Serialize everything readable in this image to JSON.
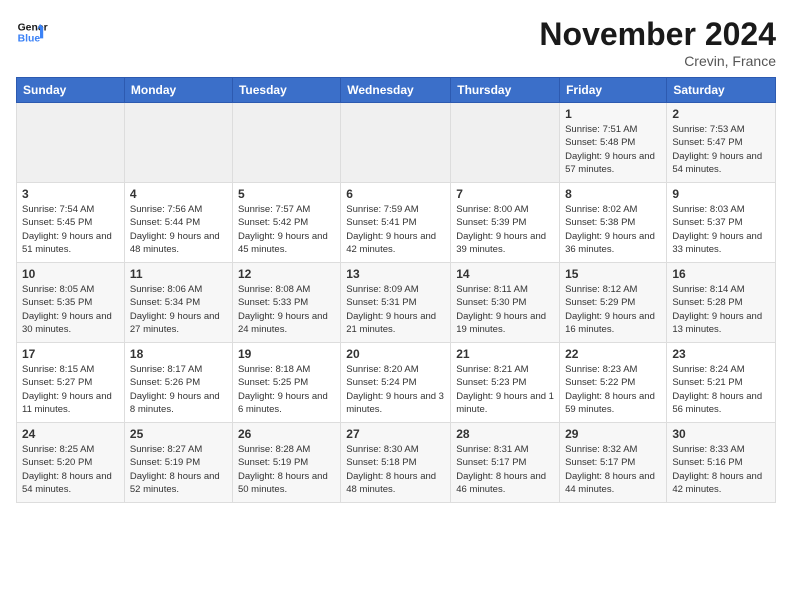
{
  "logo": {
    "line1": "General",
    "line2": "Blue"
  },
  "title": "November 2024",
  "location": "Crevin, France",
  "days_header": [
    "Sunday",
    "Monday",
    "Tuesday",
    "Wednesday",
    "Thursday",
    "Friday",
    "Saturday"
  ],
  "weeks": [
    {
      "days": [
        {
          "number": "",
          "info": ""
        },
        {
          "number": "",
          "info": ""
        },
        {
          "number": "",
          "info": ""
        },
        {
          "number": "",
          "info": ""
        },
        {
          "number": "",
          "info": ""
        },
        {
          "number": "1",
          "info": "Sunrise: 7:51 AM\nSunset: 5:48 PM\nDaylight: 9 hours and 57 minutes."
        },
        {
          "number": "2",
          "info": "Sunrise: 7:53 AM\nSunset: 5:47 PM\nDaylight: 9 hours and 54 minutes."
        }
      ]
    },
    {
      "days": [
        {
          "number": "3",
          "info": "Sunrise: 7:54 AM\nSunset: 5:45 PM\nDaylight: 9 hours and 51 minutes."
        },
        {
          "number": "4",
          "info": "Sunrise: 7:56 AM\nSunset: 5:44 PM\nDaylight: 9 hours and 48 minutes."
        },
        {
          "number": "5",
          "info": "Sunrise: 7:57 AM\nSunset: 5:42 PM\nDaylight: 9 hours and 45 minutes."
        },
        {
          "number": "6",
          "info": "Sunrise: 7:59 AM\nSunset: 5:41 PM\nDaylight: 9 hours and 42 minutes."
        },
        {
          "number": "7",
          "info": "Sunrise: 8:00 AM\nSunset: 5:39 PM\nDaylight: 9 hours and 39 minutes."
        },
        {
          "number": "8",
          "info": "Sunrise: 8:02 AM\nSunset: 5:38 PM\nDaylight: 9 hours and 36 minutes."
        },
        {
          "number": "9",
          "info": "Sunrise: 8:03 AM\nSunset: 5:37 PM\nDaylight: 9 hours and 33 minutes."
        }
      ]
    },
    {
      "days": [
        {
          "number": "10",
          "info": "Sunrise: 8:05 AM\nSunset: 5:35 PM\nDaylight: 9 hours and 30 minutes."
        },
        {
          "number": "11",
          "info": "Sunrise: 8:06 AM\nSunset: 5:34 PM\nDaylight: 9 hours and 27 minutes."
        },
        {
          "number": "12",
          "info": "Sunrise: 8:08 AM\nSunset: 5:33 PM\nDaylight: 9 hours and 24 minutes."
        },
        {
          "number": "13",
          "info": "Sunrise: 8:09 AM\nSunset: 5:31 PM\nDaylight: 9 hours and 21 minutes."
        },
        {
          "number": "14",
          "info": "Sunrise: 8:11 AM\nSunset: 5:30 PM\nDaylight: 9 hours and 19 minutes."
        },
        {
          "number": "15",
          "info": "Sunrise: 8:12 AM\nSunset: 5:29 PM\nDaylight: 9 hours and 16 minutes."
        },
        {
          "number": "16",
          "info": "Sunrise: 8:14 AM\nSunset: 5:28 PM\nDaylight: 9 hours and 13 minutes."
        }
      ]
    },
    {
      "days": [
        {
          "number": "17",
          "info": "Sunrise: 8:15 AM\nSunset: 5:27 PM\nDaylight: 9 hours and 11 minutes."
        },
        {
          "number": "18",
          "info": "Sunrise: 8:17 AM\nSunset: 5:26 PM\nDaylight: 9 hours and 8 minutes."
        },
        {
          "number": "19",
          "info": "Sunrise: 8:18 AM\nSunset: 5:25 PM\nDaylight: 9 hours and 6 minutes."
        },
        {
          "number": "20",
          "info": "Sunrise: 8:20 AM\nSunset: 5:24 PM\nDaylight: 9 hours and 3 minutes."
        },
        {
          "number": "21",
          "info": "Sunrise: 8:21 AM\nSunset: 5:23 PM\nDaylight: 9 hours and 1 minute."
        },
        {
          "number": "22",
          "info": "Sunrise: 8:23 AM\nSunset: 5:22 PM\nDaylight: 8 hours and 59 minutes."
        },
        {
          "number": "23",
          "info": "Sunrise: 8:24 AM\nSunset: 5:21 PM\nDaylight: 8 hours and 56 minutes."
        }
      ]
    },
    {
      "days": [
        {
          "number": "24",
          "info": "Sunrise: 8:25 AM\nSunset: 5:20 PM\nDaylight: 8 hours and 54 minutes."
        },
        {
          "number": "25",
          "info": "Sunrise: 8:27 AM\nSunset: 5:19 PM\nDaylight: 8 hours and 52 minutes."
        },
        {
          "number": "26",
          "info": "Sunrise: 8:28 AM\nSunset: 5:19 PM\nDaylight: 8 hours and 50 minutes."
        },
        {
          "number": "27",
          "info": "Sunrise: 8:30 AM\nSunset: 5:18 PM\nDaylight: 8 hours and 48 minutes."
        },
        {
          "number": "28",
          "info": "Sunrise: 8:31 AM\nSunset: 5:17 PM\nDaylight: 8 hours and 46 minutes."
        },
        {
          "number": "29",
          "info": "Sunrise: 8:32 AM\nSunset: 5:17 PM\nDaylight: 8 hours and 44 minutes."
        },
        {
          "number": "30",
          "info": "Sunrise: 8:33 AM\nSunset: 5:16 PM\nDaylight: 8 hours and 42 minutes."
        }
      ]
    }
  ]
}
